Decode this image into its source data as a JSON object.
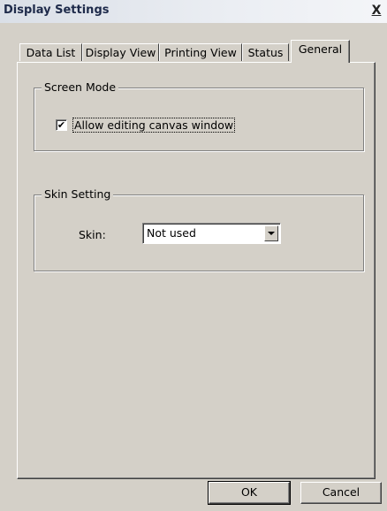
{
  "window": {
    "title": "Display Settings",
    "close_label": "X"
  },
  "tabs": [
    {
      "label": "Data List",
      "active": false
    },
    {
      "label": "Display View",
      "active": false
    },
    {
      "label": "Printing View",
      "active": false
    },
    {
      "label": "Status",
      "active": false
    },
    {
      "label": "General",
      "active": true
    }
  ],
  "screen_mode": {
    "legend": "Screen Mode",
    "checkbox_label": "Allow editing canvas window",
    "checked": true,
    "check_glyph": "✔"
  },
  "skin_setting": {
    "legend": "Skin Setting",
    "skin_label": "Skin:",
    "skin_value": "Not used"
  },
  "buttons": {
    "ok": "OK",
    "cancel": "Cancel"
  }
}
